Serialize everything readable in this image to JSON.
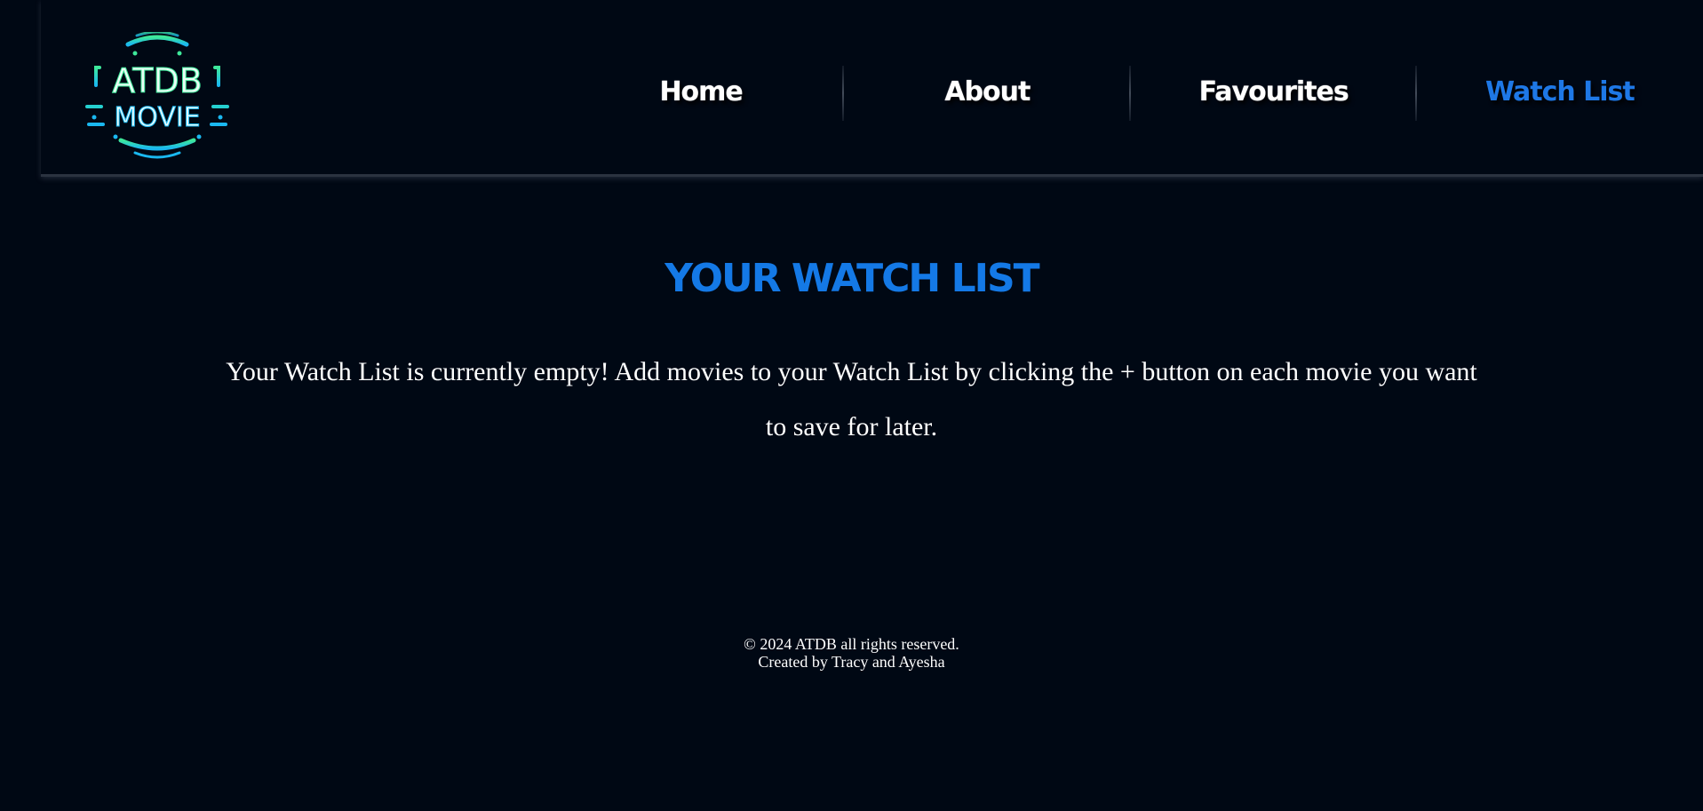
{
  "header": {
    "logo": {
      "line1": "ATDB",
      "line2": "MOVIE",
      "gradient_top": "#3ee89a",
      "gradient_bottom": "#1ab8f0"
    },
    "nav": [
      {
        "label": "Home",
        "active": false
      },
      {
        "label": "About",
        "active": false
      },
      {
        "label": "Favourites",
        "active": false
      },
      {
        "label": "Watch List",
        "active": true
      }
    ]
  },
  "main": {
    "title": "YOUR WATCH LIST",
    "message": "Your Watch List is currently empty! Add movies to your Watch List by clicking the + button on each movie you want to save for later."
  },
  "footer": {
    "copyright": "© 2024 ATDB all rights reserved.",
    "credits": "Created by Tracy and Ayesha"
  },
  "colors": {
    "background": "#000814",
    "accent": "#1479e6",
    "text": "#ffffff"
  }
}
